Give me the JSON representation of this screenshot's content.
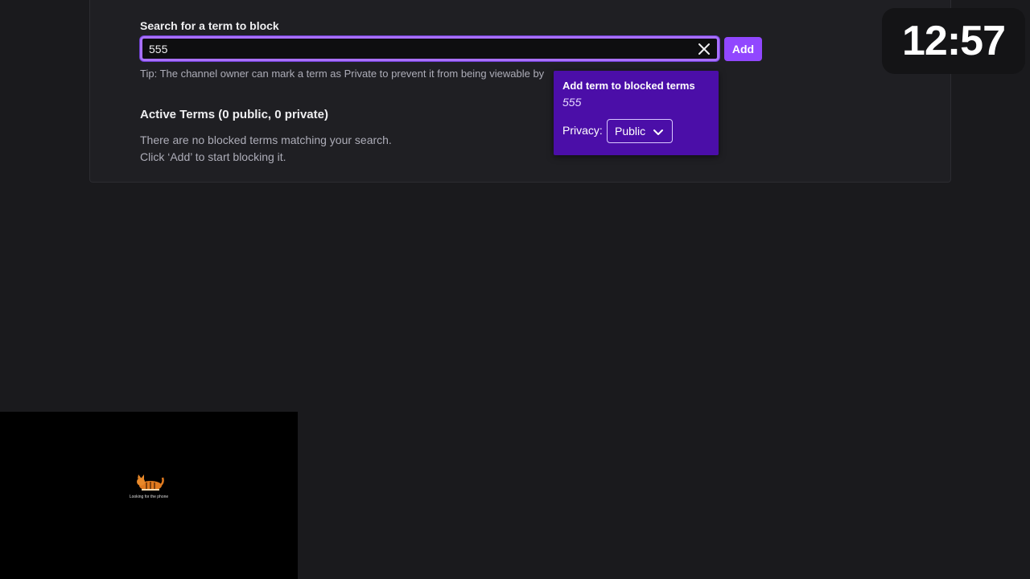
{
  "search": {
    "label": "Search for a term to block",
    "value": "555",
    "add_label": "Add",
    "tip": "Tip: The channel owner can mark a term as Private to prevent it from being viewable by"
  },
  "active_terms": {
    "title": "Active Terms (0 public, 0 private)",
    "empty_line1": "There are no blocked terms matching your search.",
    "empty_line2": "Click ‘Add’ to start blocking it."
  },
  "popover": {
    "title": "Add term to blocked terms",
    "term": "555",
    "privacy_label": "Privacy:",
    "privacy_value": "Public"
  },
  "clock": {
    "time": "12:57"
  },
  "webcam": {
    "caption": "Looking for the phone"
  },
  "colors": {
    "accent": "#9147ff",
    "focus_ring": "#a970ff",
    "popover_bg": "#4b0ea8",
    "page_bg": "#1a1a1d"
  },
  "icons": {
    "clear": "close-icon",
    "dropdown": "chevron-down-icon",
    "webcam_figure": "cat-icon"
  }
}
